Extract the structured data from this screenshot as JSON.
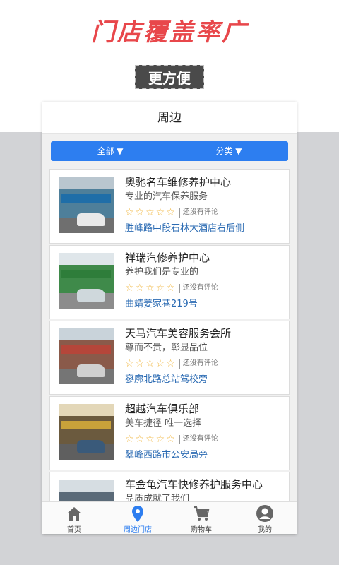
{
  "promo": {
    "title": "门店覆盖率广",
    "badge": "更方便"
  },
  "header": {
    "title": "周边"
  },
  "filters": {
    "all": "全部 ▼",
    "category": "分类 ▼"
  },
  "shops": [
    {
      "name": "奥驰名车维修养护中心",
      "desc": "专业的汽车保养服务",
      "stars": "☆☆☆☆☆",
      "reviews": "还没有评论",
      "address": "胜峰路中段石林大酒店右后侧"
    },
    {
      "name": "祥瑞汽修养护中心",
      "desc": "养护我们是专业的",
      "stars": "☆☆☆☆☆",
      "reviews": "还没有评论",
      "address": "曲靖姜家巷219号"
    },
    {
      "name": "天马汽车美容服务会所",
      "desc": "尊而不贵，彰显品位",
      "stars": "☆☆☆☆☆",
      "reviews": "还没有评论",
      "address": "寥廓北路总站驾校旁"
    },
    {
      "name": "超越汽车俱乐部",
      "desc": "美车捷径 唯一选择",
      "stars": "☆☆☆☆☆",
      "reviews": "还没有评论",
      "address": "翠峰西路市公安局旁"
    },
    {
      "name": "车金龟汽车快修养护服务中心",
      "desc": "品质成就了我们",
      "stars": "",
      "reviews": "",
      "address": ""
    }
  ],
  "tabs": [
    {
      "label": "首页",
      "icon": "home-icon"
    },
    {
      "label": "周边门店",
      "icon": "location-pin-icon"
    },
    {
      "label": "购物车",
      "icon": "cart-icon"
    },
    {
      "label": "我的",
      "icon": "user-icon"
    }
  ],
  "colors": {
    "accent": "#2d7ef0",
    "promo_red": "#e8474b",
    "address_link": "#2b6bb3",
    "star": "#f0b43a"
  }
}
